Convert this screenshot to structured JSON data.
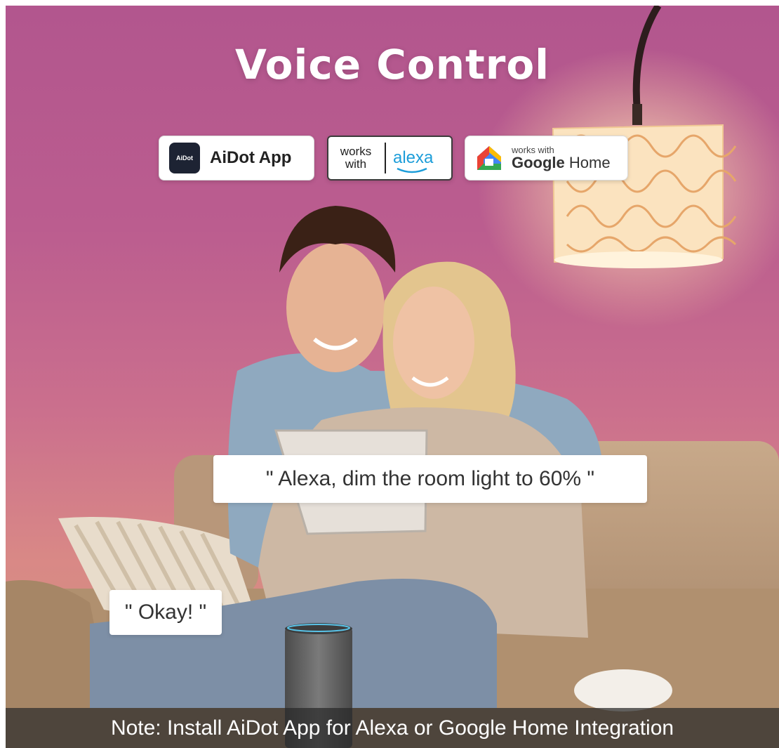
{
  "title": "Voice Control",
  "badges": {
    "aidot": {
      "logo_text": "AiDot",
      "label": "AiDot App"
    },
    "alexa": {
      "works": "works",
      "with": "with",
      "brand": "alexa"
    },
    "google": {
      "small": "works with",
      "brand_bold": "Google",
      "brand_rest": " Home"
    }
  },
  "bubbles": {
    "command": "\" Alexa, dim the room light to 60% \"",
    "reply": "\" Okay! \""
  },
  "note": "Note: Install AiDot App for Alexa or Google Home Integration",
  "colors": {
    "background_top": "#b2568e",
    "background_bottom": "#d98986",
    "alexa_blue": "#1c9dd9",
    "aidot_logo_bg": "#1d2333"
  }
}
